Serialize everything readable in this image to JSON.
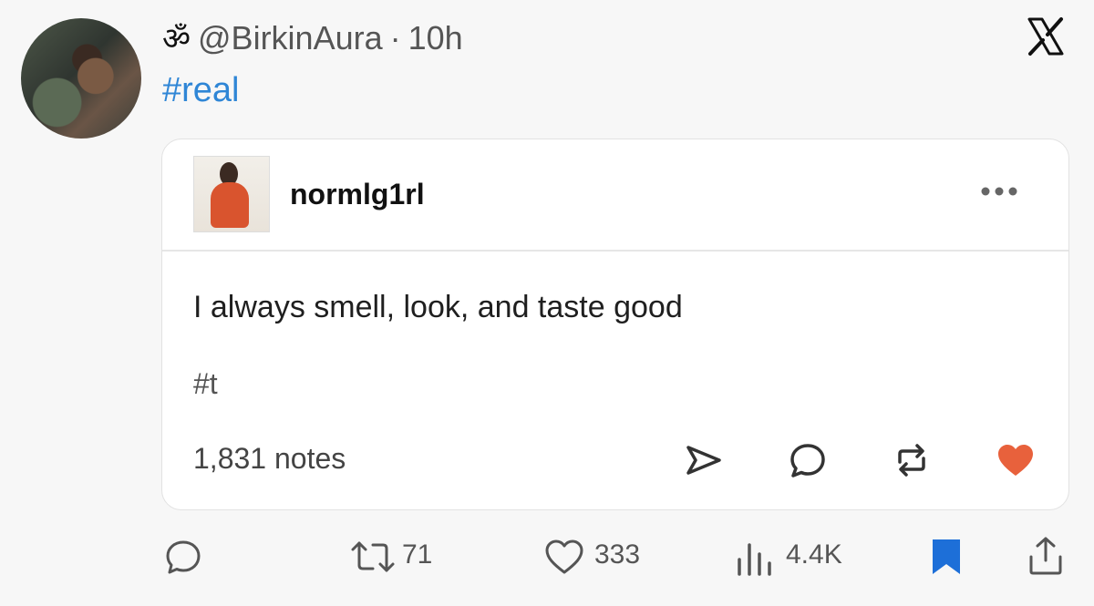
{
  "tweet": {
    "author_symbol": "ॐ",
    "handle": "@BirkinAura",
    "separator": "·",
    "time": "10h",
    "text": "#real"
  },
  "embedded_post": {
    "username": "normlg1rl",
    "body": "I always smell, look, and taste good",
    "tag": "#t",
    "notes": "1,831 notes",
    "heart_color": "#e8613c"
  },
  "actions": {
    "retweets": "71",
    "likes": "333",
    "views": "4.4K"
  },
  "colors": {
    "link": "#2f86d6",
    "bookmark": "#1d6fd8"
  }
}
